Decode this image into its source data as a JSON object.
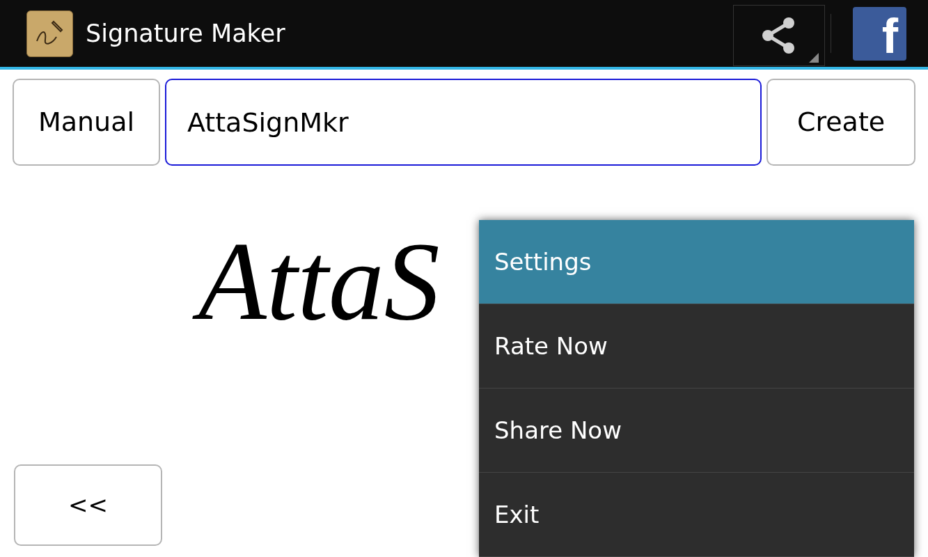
{
  "action_bar": {
    "title": "Signature Maker",
    "facebook_label": "f"
  },
  "toolbar": {
    "manual_button": "Manual",
    "name_field": {
      "value": "AttaSignMkr"
    },
    "create_button": "Create"
  },
  "signature": {
    "text": "AttaS"
  },
  "back_button": "<<",
  "menu": {
    "items": [
      {
        "label": "Settings",
        "selected": true
      },
      {
        "label": "Rate Now",
        "selected": false
      },
      {
        "label": "Share Now",
        "selected": false
      },
      {
        "label": "Exit",
        "selected": false
      }
    ]
  }
}
